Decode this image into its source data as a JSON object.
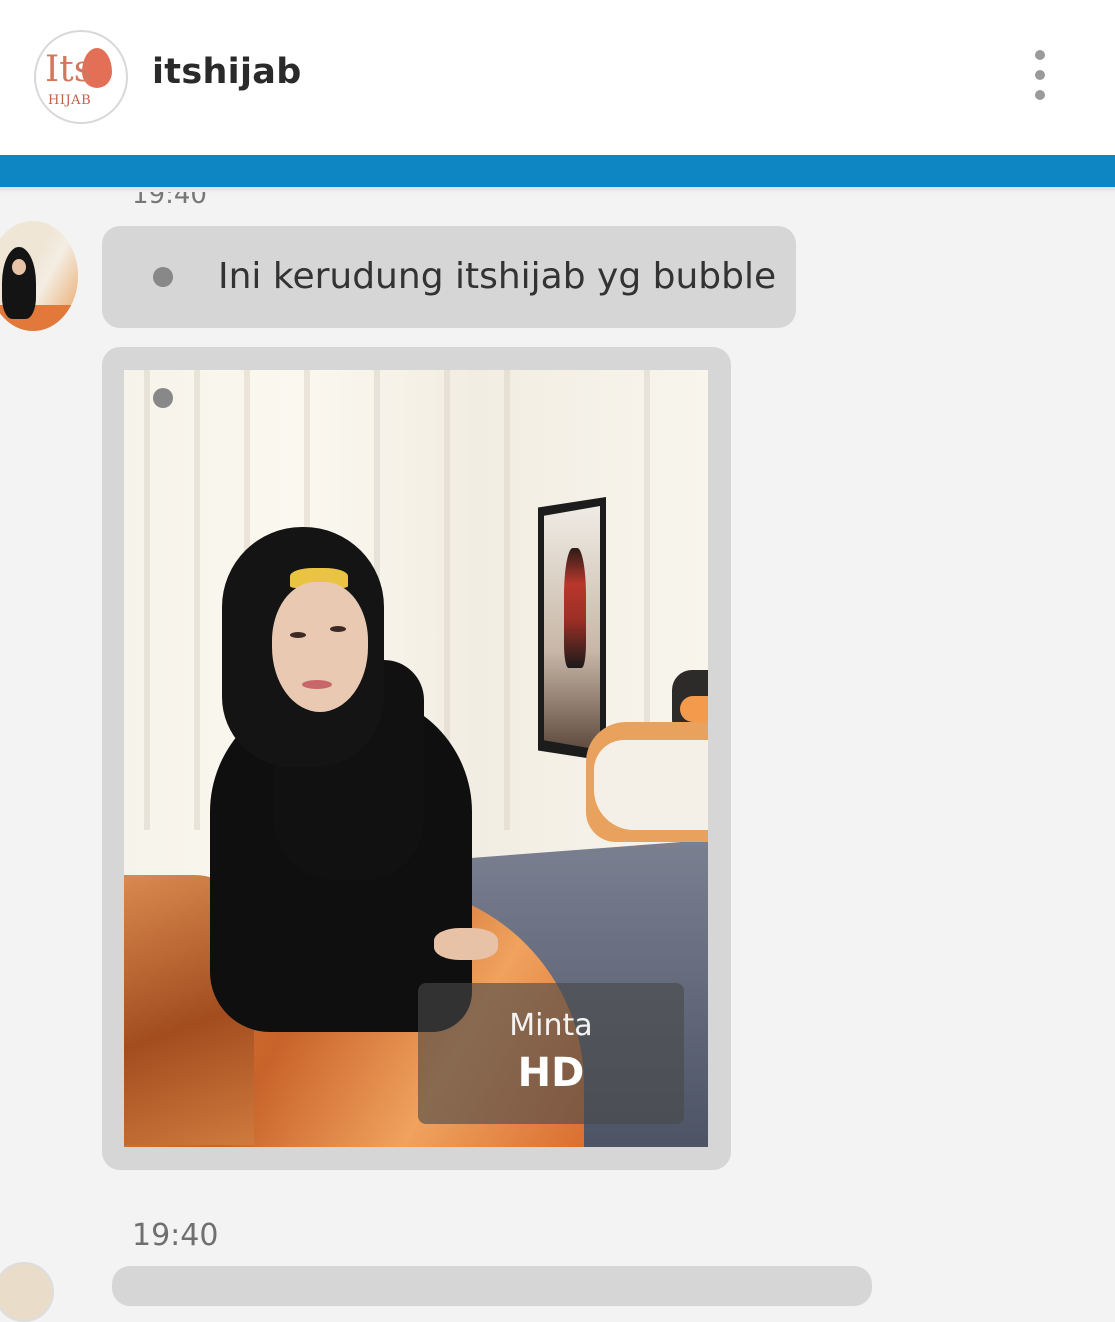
{
  "header": {
    "logo": {
      "text_top": "Its",
      "text_bottom": "HIJAB"
    },
    "title": "itshijab",
    "menu_icon": "more-vertical-icon",
    "accent_color": "#0d86c3"
  },
  "messages": [
    {
      "type": "text",
      "text": "Ini kerudung itshijab yg bubble"
    },
    {
      "type": "image",
      "overlay_line1": "Minta",
      "overlay_line2": "HD"
    }
  ],
  "timestamps": {
    "previous_partial": "19:40",
    "current": "19:40"
  },
  "colors": {
    "bubble": "#d6d6d6",
    "background": "#f3f3f3"
  }
}
